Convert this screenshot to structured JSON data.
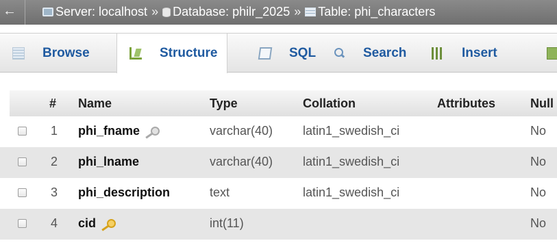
{
  "breadcrumb": {
    "back_glyph": "←",
    "separator": "»",
    "items": [
      {
        "icon": "server-icon",
        "label": "Server: localhost"
      },
      {
        "icon": "database-icon",
        "label": "Database: philr_2025"
      },
      {
        "icon": "table-icon",
        "label": "Table: phi_characters"
      }
    ]
  },
  "tabs": [
    {
      "icon": "browse-icon",
      "label": "Browse",
      "active": false
    },
    {
      "icon": "structure-icon",
      "label": "Structure",
      "active": true
    },
    {
      "icon": "sql-icon",
      "label": "SQL",
      "active": false
    },
    {
      "icon": "search-icon",
      "label": "Search",
      "active": false
    },
    {
      "icon": "insert-icon",
      "label": "Insert",
      "active": false
    }
  ],
  "columns": {
    "num": "#",
    "name": "Name",
    "type": "Type",
    "collation": "Collation",
    "attributes": "Attributes",
    "null": "Null"
  },
  "rows": [
    {
      "num": "1",
      "name": "phi_fname",
      "key": "grey-key-icon",
      "type": "varchar(40)",
      "collation": "latin1_swedish_ci",
      "attributes": "",
      "null": "No"
    },
    {
      "num": "2",
      "name": "phi_lname",
      "key": "",
      "type": "varchar(40)",
      "collation": "latin1_swedish_ci",
      "attributes": "",
      "null": "No"
    },
    {
      "num": "3",
      "name": "phi_description",
      "key": "",
      "type": "text",
      "collation": "latin1_swedish_ci",
      "attributes": "",
      "null": "No"
    },
    {
      "num": "4",
      "name": "cid",
      "key": "gold-key-icon",
      "type": "int(11)",
      "collation": "",
      "attributes": "",
      "null": "No"
    }
  ],
  "colors": {
    "tab_text": "#1f5aa0",
    "breadcrumb_bg": "#7d7d7d",
    "row_shade": "#e6e6e6",
    "primary_key": "#d6a21b"
  }
}
